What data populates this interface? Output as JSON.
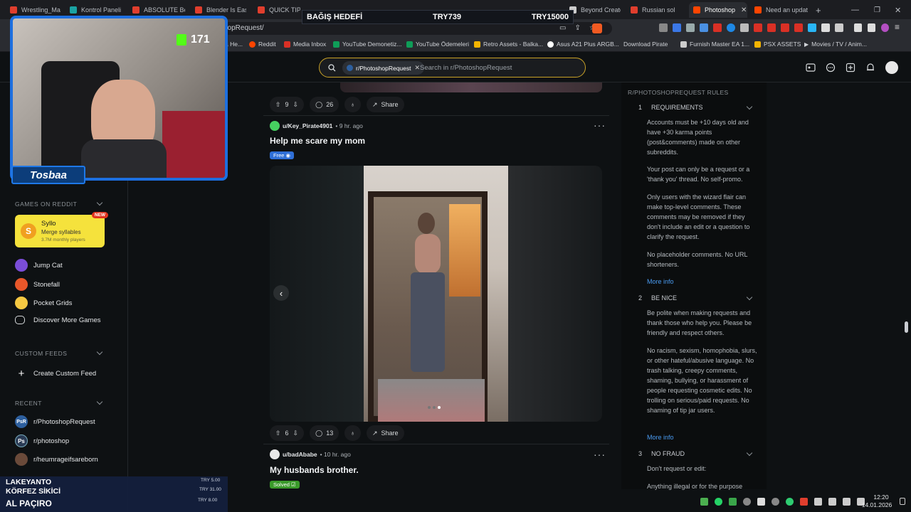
{
  "tabs": [
    {
      "label": "Wrestling_Ma",
      "color": "#e03e2d"
    },
    {
      "label": "Kontrol Paneli",
      "color": "#1aa3a3"
    },
    {
      "label": "ABSOLUTE Beg",
      "color": "#e03e2d"
    },
    {
      "label": "Blender Is Easie",
      "color": "#e03e2d"
    },
    {
      "label": "QUICK TIPS",
      "color": "#e03e2d"
    },
    {
      "label": "Beyond Creato",
      "color": "#cccccc"
    },
    {
      "label": "Russian sol",
      "color": "#e03e2d"
    },
    {
      "label": "Photoshop",
      "color": "#ff4500"
    },
    {
      "label": "Need an updat",
      "color": "#ff4500"
    }
  ],
  "address": {
    "url": "hopRequest/"
  },
  "bookmarks": [
    {
      "label": "a He...",
      "color": "#888888"
    },
    {
      "label": "Reddit",
      "color": "#ff4500"
    },
    {
      "label": "Media Inbox",
      "color": "#d93025"
    },
    {
      "label": "YouTube Demonetiz...",
      "color": "#0f9d58"
    },
    {
      "label": "YouTube Ödemeleri",
      "color": "#0f9d58"
    },
    {
      "label": "Retro Assets - Balka...",
      "color": "#f4b400"
    },
    {
      "label": "Asus A21 Plus ARGB...",
      "color": "#ffffff"
    },
    {
      "label": "Download Pirate",
      "color": "#888888"
    },
    {
      "label": "Furnish Master EA 1...",
      "color": "#cccccc"
    },
    {
      "label": "PSX ASSETS",
      "color": "#f4b400"
    },
    {
      "label": "Movies / TV / Anim...",
      "color": "#cccccc"
    }
  ],
  "search": {
    "chip": "r/PhotoshopRequest",
    "placeholder": "Search in r/PhotoshopRequest"
  },
  "sidebar": {
    "games_title": "GAMES ON REDDIT",
    "syllo": {
      "name": "Syllo",
      "tagline": "Merge syllables",
      "players": "3.7M monthly players",
      "badge": "NEW"
    },
    "games": [
      {
        "label": "Jump Cat",
        "color": "#7a4dd8"
      },
      {
        "label": "Stonefall",
        "color": "#e8572a"
      },
      {
        "label": "Pocket Grids",
        "color": "#f5c842"
      },
      {
        "label": "Discover More Games",
        "color": "#0e1113"
      }
    ],
    "custom_title": "CUSTOM FEEDS",
    "create_feed": "Create Custom Feed",
    "recent_title": "RECENT",
    "recent": [
      {
        "label": "r/PhotoshopRequest",
        "icon": "PsR",
        "color": "#2d5f9e"
      },
      {
        "label": "r/photoshop",
        "icon": "Ps",
        "color": "#2a3b55"
      },
      {
        "label": "r/heumrageifsareborn",
        "icon": "",
        "color": "#6a4a3a"
      }
    ]
  },
  "posts": [
    {
      "votes": "9",
      "comments": "26",
      "share": "Share"
    },
    {
      "author": "u/Key_Pirate4901",
      "time": "9 hr. ago",
      "title": "Help me scare my mom",
      "flair": "Free",
      "flair_color": "#2f6fd6",
      "votes": "6",
      "comments": "13",
      "share": "Share"
    },
    {
      "author": "u/badAbabe",
      "time": "10 hr. ago",
      "title": "My husbands brother.",
      "flair": "Solved",
      "flair_color": "#3a9a2a"
    }
  ],
  "rules": {
    "title": "R/PHOTOSHOPREQUEST RULES",
    "items": [
      {
        "num": "1",
        "name": "REQUIREMENTS"
      },
      {
        "num": "2",
        "name": "BE NICE"
      },
      {
        "num": "3",
        "name": "NO FRAUD"
      }
    ],
    "r1_texts": [
      "Accounts must be +10 days old and have +30 karma points (post&comments) made on other subreddits.",
      "Your post can only be a request or a 'thank you' thread. No self-promo.",
      "Only users with the wizard flair can make top-level comments. These comments may be removed if they don't include an edit or a question to clarify the request.",
      "No placeholder comments. No URL shorteners."
    ],
    "r2_texts": [
      "Be polite when making requests and thank those who help you. Please be friendly and respect others.",
      "No racism, sexism, homophobia, slurs, or other hateful/abusive language. No trash talking, creepy comments, shaming, bullying, or harassment of people requesting cosmetic edits. No trolling on serious/paid requests. No shaming of tip jar users."
    ],
    "r3_texts": [
      "Don't request or edit:",
      "Anything illegal or for the purpose"
    ],
    "more": "More info"
  },
  "stream": {
    "goal_label": "BAĞIŞ HEDEFİ",
    "goal_current": "TRY739",
    "goal_target": "TRY15000",
    "counter": "171",
    "name": "Tosbaa",
    "donors": [
      {
        "name": "LAKEYANTO",
        "amount": "TRY 5.00"
      },
      {
        "name": "KÖRFEZ SİKİCİ",
        "amount": "TRY 31.00"
      },
      {
        "name": "AL PAÇIRO",
        "amount": "TRY 8.00"
      }
    ]
  },
  "clock": {
    "time": "12:20",
    "date": "14.01.2026"
  }
}
